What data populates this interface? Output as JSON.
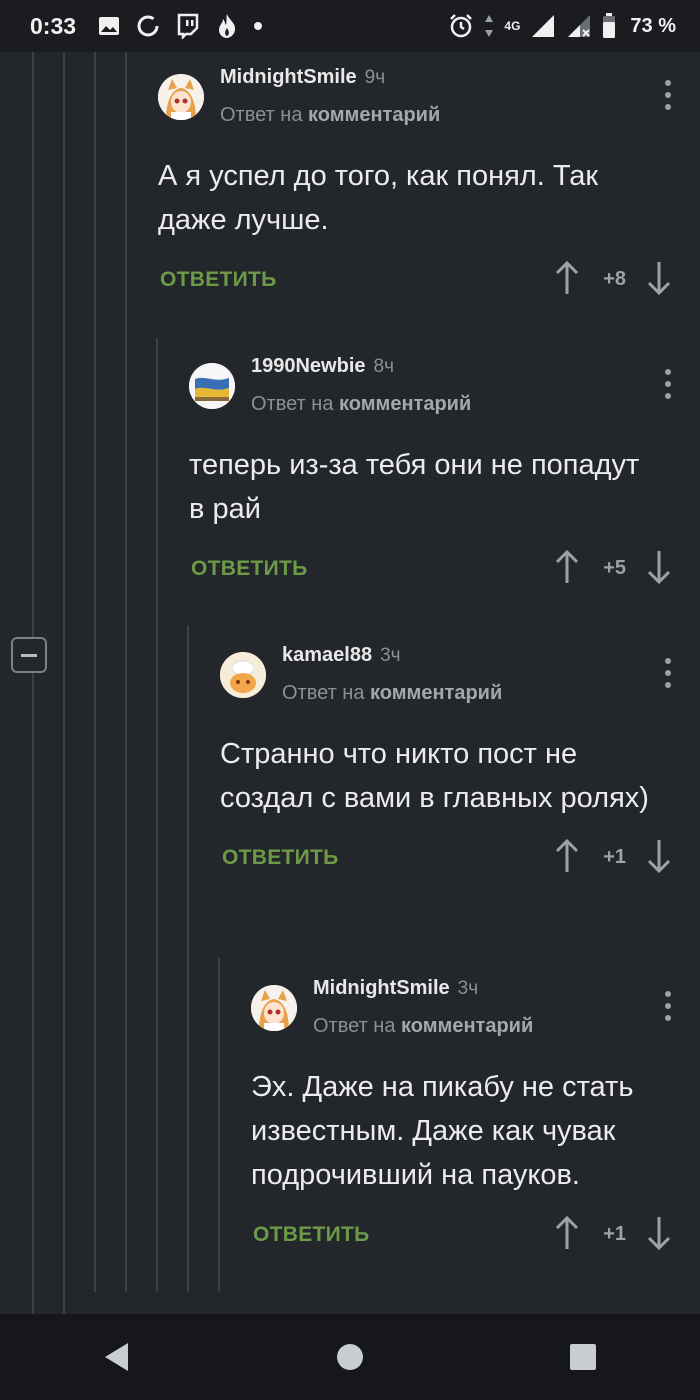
{
  "status_bar": {
    "time": "0:33",
    "network": "4G",
    "battery": "73 %",
    "icons": [
      "gallery-icon",
      "sync-icon",
      "twitch-icon",
      "fire-icon",
      "dot-icon",
      "alarm-icon",
      "signal-icon",
      "battery-icon"
    ]
  },
  "comments": [
    {
      "username": "MidnightSmile",
      "time": "9ч",
      "reply_prefix": "Ответ на",
      "reply_target": "комментарий",
      "body": "А я успел до того, как понял. Так даже лучше.",
      "reply_label": "ОТВЕТИТЬ",
      "score": "+8",
      "avatar": "anime-girl-avatar"
    },
    {
      "username": "1990Newbie",
      "time": "8ч",
      "reply_prefix": "Ответ на",
      "reply_target": "комментарий",
      "body": "теперь из-за тебя они не попадут в рай",
      "reply_label": "ОТВЕТИТЬ",
      "score": "+5",
      "avatar": "flag-avatar"
    },
    {
      "username": "kamael88",
      "time": "3ч",
      "reply_prefix": "Ответ на",
      "reply_target": "комментарий",
      "body": "Странно что никто пост не создал с вами в главных ролях)",
      "reply_label": "ОТВЕТИТЬ",
      "score": "+1",
      "avatar": "cook-avatar"
    },
    {
      "username": "MidnightSmile",
      "time": "3ч",
      "reply_prefix": "Ответ на",
      "reply_target": "комментарий",
      "body": "Эх. Даже на пикабу не стать известным. Даже как чувак подрочивший на пауков.",
      "reply_label": "ОТВЕТИТЬ",
      "score": "+1",
      "avatar": "anime-girl-avatar"
    }
  ],
  "colors": {
    "background": "#23262b",
    "reply_green": "#6d9a46",
    "muted_text": "#8b8f96"
  }
}
